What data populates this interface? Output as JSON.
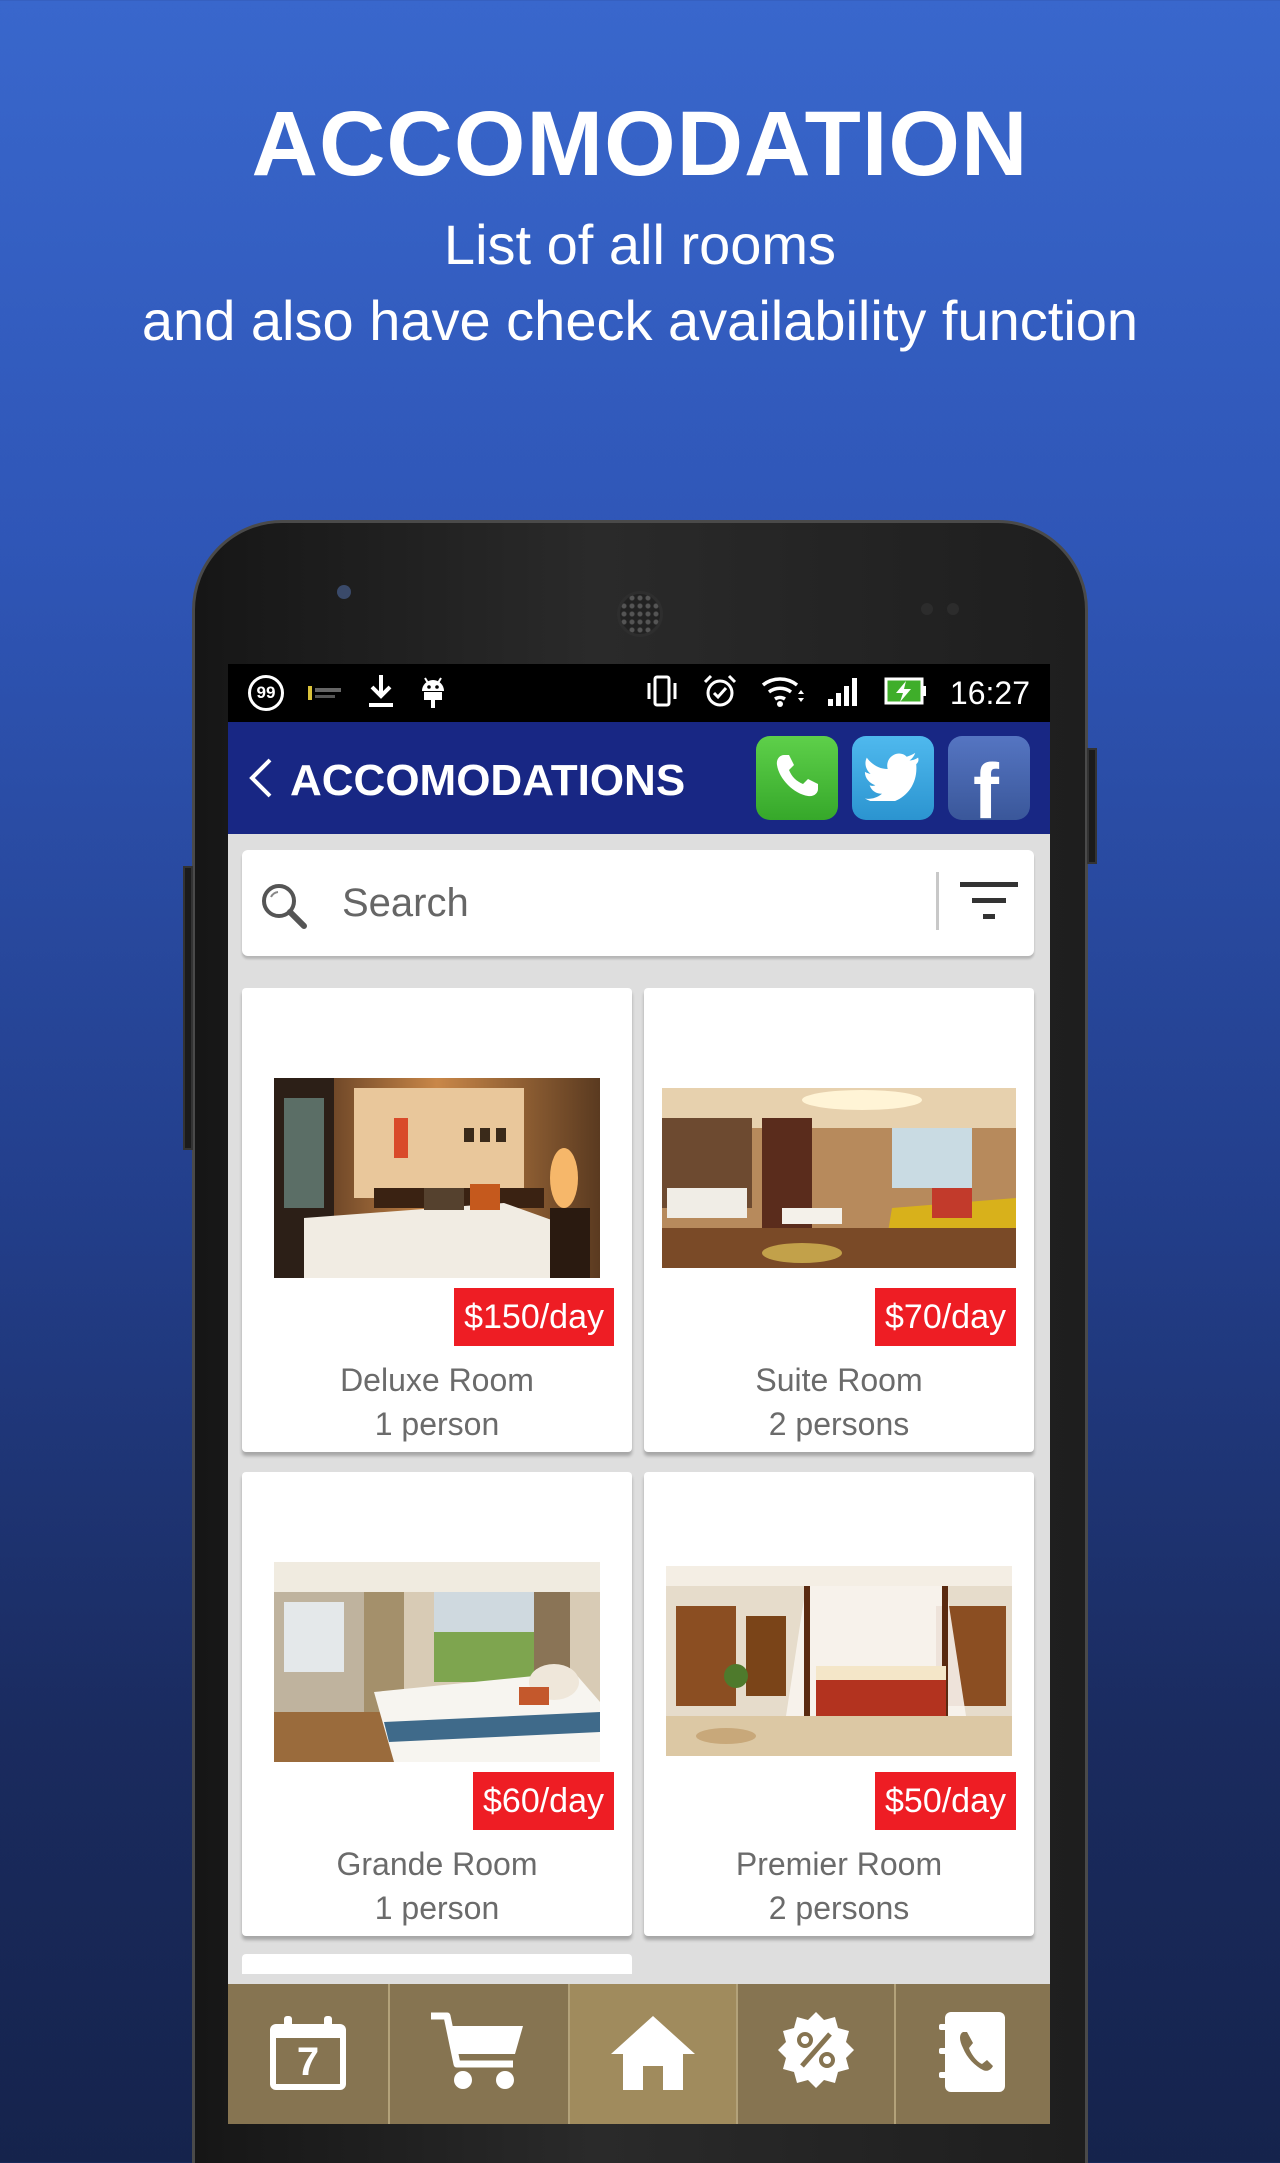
{
  "promo": {
    "title": "ACCOMODATION",
    "line1": "List of all rooms",
    "line2": "and also have check availability function"
  },
  "status_bar": {
    "notif_badge": "99",
    "time": "16:27"
  },
  "app_bar": {
    "title": "ACCOMODATIONS",
    "icons": [
      "back-icon",
      "phone-icon",
      "twitter-icon",
      "facebook-icon"
    ],
    "colors": {
      "bar": "#182784",
      "phone": "#47bd37",
      "twitter": "#3aa7e0",
      "facebook": "#4563ad"
    }
  },
  "search": {
    "placeholder": "Search"
  },
  "rooms": [
    {
      "name": "Deluxe Room",
      "capacity": "1 person",
      "price": "$150/day"
    },
    {
      "name": "Suite Room",
      "capacity": "2 persons",
      "price": "$70/day"
    },
    {
      "name": "Grande Room",
      "capacity": "1 person",
      "price": "$60/day"
    },
    {
      "name": "Premier Room",
      "capacity": "2 persons",
      "price": "$50/day"
    }
  ],
  "bottom_nav": {
    "calendar_day": "7",
    "items": [
      "calendar-icon",
      "cart-icon",
      "home-icon",
      "discount-icon",
      "contact-book-icon"
    ],
    "active": "home-icon"
  },
  "colors": {
    "price_tag": "#ee1d24",
    "nav": "#867451"
  }
}
